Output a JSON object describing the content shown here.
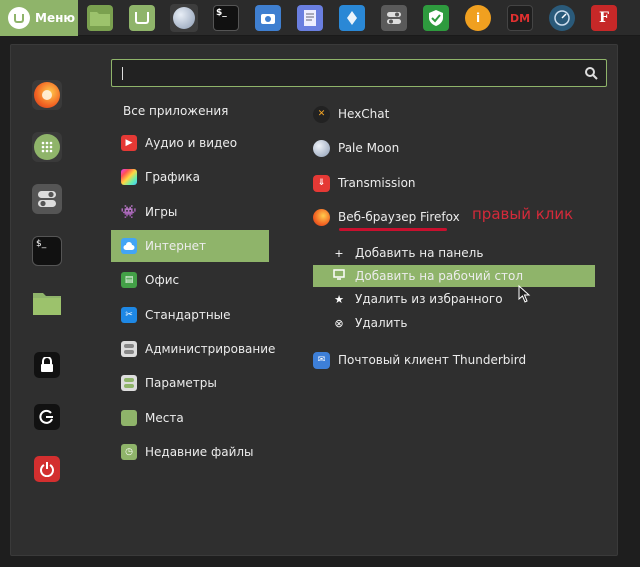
{
  "panel": {
    "menu_label": "Меню",
    "launchers": [
      {
        "icon": "folder-icon"
      },
      {
        "icon": "mint-update-icon"
      },
      {
        "icon": "pale-moon-icon"
      },
      {
        "icon": "terminal-icon"
      },
      {
        "icon": "camera-icon"
      },
      {
        "icon": "text-editor-icon"
      },
      {
        "icon": "software-icon"
      },
      {
        "icon": "settings-icon"
      },
      {
        "icon": "shield-icon"
      },
      {
        "icon": "info-icon"
      },
      {
        "icon": "dm-icon",
        "text": "DM"
      },
      {
        "icon": "monitor-icon"
      },
      {
        "icon": "font-icon"
      }
    ]
  },
  "favorites": [
    {
      "icon": "firefox-icon"
    },
    {
      "icon": "software-manager-icon"
    },
    {
      "icon": "settings-icon"
    },
    {
      "icon": "terminal-icon"
    },
    {
      "icon": "folder-icon"
    },
    {
      "icon": "lock-icon"
    },
    {
      "icon": "logout-icon"
    },
    {
      "icon": "power-icon"
    }
  ],
  "search": {
    "placeholder": ""
  },
  "categories": {
    "all": "Все приложения",
    "audio": "Аудио и видео",
    "graphics": "Графика",
    "games": "Игры",
    "internet": "Интернет",
    "office": "Офис",
    "accessories": "Стандартные",
    "administration": "Администрирование",
    "preferences": "Параметры",
    "places": "Места",
    "recent": "Недавние файлы"
  },
  "apps": {
    "hexchat": "HexChat",
    "palemoon": "Pale Moon",
    "transmission": "Transmission",
    "firefox": "Веб-браузер Firefox",
    "thunderbird": "Почтовый клиент Thunderbird"
  },
  "context_menu": {
    "add_panel": "Добавить на панель",
    "add_desktop": "Добавить на рабочий стол",
    "remove_fav": "Удалить из избранного",
    "remove": "Удалить"
  },
  "annotation": "правый клик",
  "colors": {
    "accent": "#8fb46a",
    "annotation": "#d42a3a"
  }
}
